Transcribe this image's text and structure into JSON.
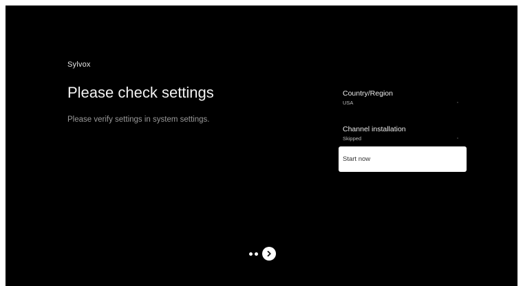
{
  "brand": {
    "name": "Sylvox"
  },
  "page": {
    "title": "Please check settings",
    "subtitle": "Please verify settings in system settings."
  },
  "settings": [
    {
      "label": "Country/Region",
      "value": "USA"
    },
    {
      "label": "Channel installation",
      "value": "Skipped"
    }
  ],
  "actions": {
    "start_label": "Start now"
  },
  "pager": {
    "icon": "chevron-right-icon"
  },
  "colors": {
    "background": "#000000",
    "focus": "#ffffff",
    "subtitle": "#9a9a9a"
  }
}
